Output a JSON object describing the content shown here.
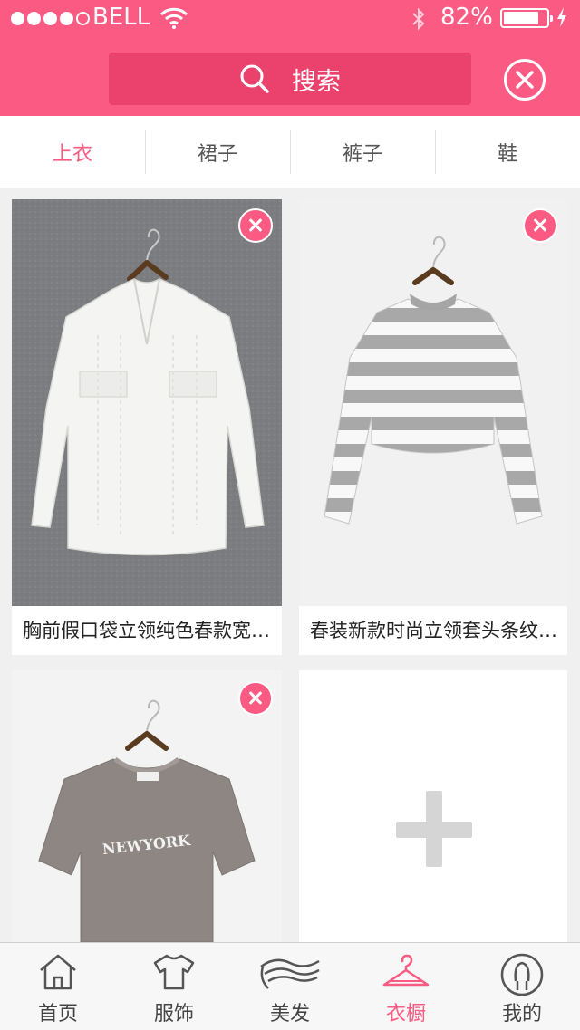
{
  "status_bar": {
    "carrier": "BELL",
    "battery_pct": "82%",
    "battery_level": 0.82
  },
  "search": {
    "label": "搜索"
  },
  "tabs": [
    {
      "label": "上衣",
      "active": true
    },
    {
      "label": "裙子",
      "active": false
    },
    {
      "label": "裤子",
      "active": false
    },
    {
      "label": "鞋",
      "active": false
    }
  ],
  "items": [
    {
      "caption": "胸前假口袋立领纯色春款宽松白色衬衫",
      "image": "white-blouse"
    },
    {
      "caption": "春装新款时尚立领套头条纹卫衣",
      "image": "striped-sweater"
    },
    {
      "caption": "",
      "image": "grey-tshirt",
      "print": "NEWYORK"
    }
  ],
  "bottom_nav": [
    {
      "label": "首页",
      "icon": "home-icon",
      "active": false
    },
    {
      "label": "服饰",
      "icon": "tshirt-icon",
      "active": false
    },
    {
      "label": "美发",
      "icon": "hair-icon",
      "active": false
    },
    {
      "label": "衣橱",
      "icon": "hanger-icon",
      "active": true
    },
    {
      "label": "我的",
      "icon": "profile-icon",
      "active": false
    }
  ],
  "colors": {
    "accent": "#fb5b83",
    "search_bg": "#ea426d"
  }
}
